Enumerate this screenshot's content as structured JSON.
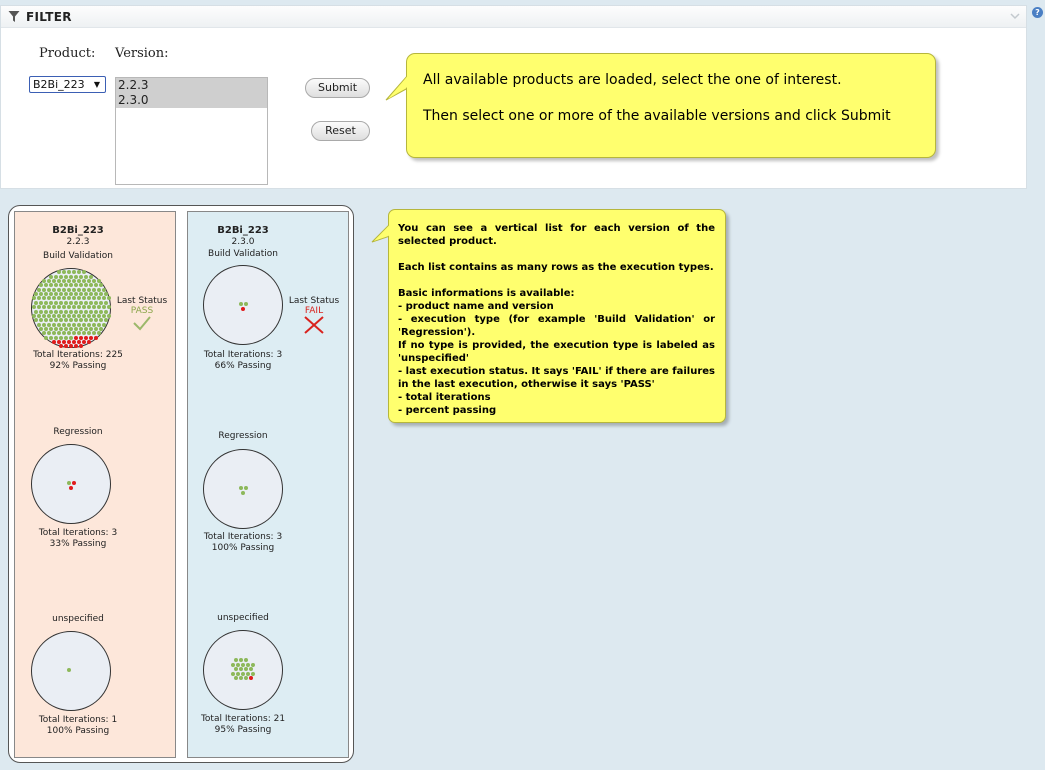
{
  "filter": {
    "title": "FILTER",
    "product_label": "Product:",
    "version_label": "Version:",
    "product_selected": "B2Bi_223",
    "versions": [
      "2.2.3",
      "2.3.0"
    ],
    "submit_label": "Submit",
    "reset_label": "Reset",
    "help_icon": "?"
  },
  "callouts": {
    "filter_tip": [
      "All available products are loaded, select the one of interest.",
      "Then select one or more of the available versions and click Submit"
    ],
    "results_tip": {
      "p1": "You can see a vertical list for each version of the selected product.",
      "p2": "Each list contains as many rows as the execution types.",
      "p3_title": "Basic informations is available:",
      "bullets": [
        "- product name and version",
        "- execution type (for example 'Build Validation' or 'Regression').",
        "If no type is provided, the execution type is labeled as 'unspecified'",
        "- last execution status. It says 'FAIL' if there are failures in the last execution, otherwise it says 'PASS'",
        "- total iterations",
        "- percent passing"
      ]
    }
  },
  "colors": {
    "pass_dot": "#8db85a",
    "fail_dot": "#e01c1c",
    "pass_status": "#8ca64b",
    "fail_status": "#d9231e"
  },
  "columns": [
    {
      "product": "B2Bi_223",
      "version": "2.2.3",
      "last_status_label": "Last Status",
      "last_status": "PASS",
      "rows": [
        {
          "type": "Build Validation",
          "iterations": "Total Iterations: 225",
          "passing": "92% Passing",
          "pass": 207,
          "fail": 18
        },
        {
          "type": "Regression",
          "iterations": "Total Iterations: 3",
          "passing": "33% Passing",
          "pass": 1,
          "fail": 2
        },
        {
          "type": "unspecified",
          "iterations": "Total Iterations: 1",
          "passing": "100% Passing",
          "pass": 1,
          "fail": 0
        }
      ]
    },
    {
      "product": "B2Bi_223",
      "version": "2.3.0",
      "last_status_label": "Last Status",
      "last_status": "FAIL",
      "rows": [
        {
          "type": "Build Validation",
          "iterations": "Total Iterations: 3",
          "passing": "66% Passing",
          "pass": 2,
          "fail": 1
        },
        {
          "type": "Regression",
          "iterations": "Total Iterations: 3",
          "passing": "100% Passing",
          "pass": 3,
          "fail": 0
        },
        {
          "type": "unspecified",
          "iterations": "Total Iterations: 21",
          "passing": "95% Passing",
          "pass": 20,
          "fail": 1
        }
      ]
    }
  ]
}
